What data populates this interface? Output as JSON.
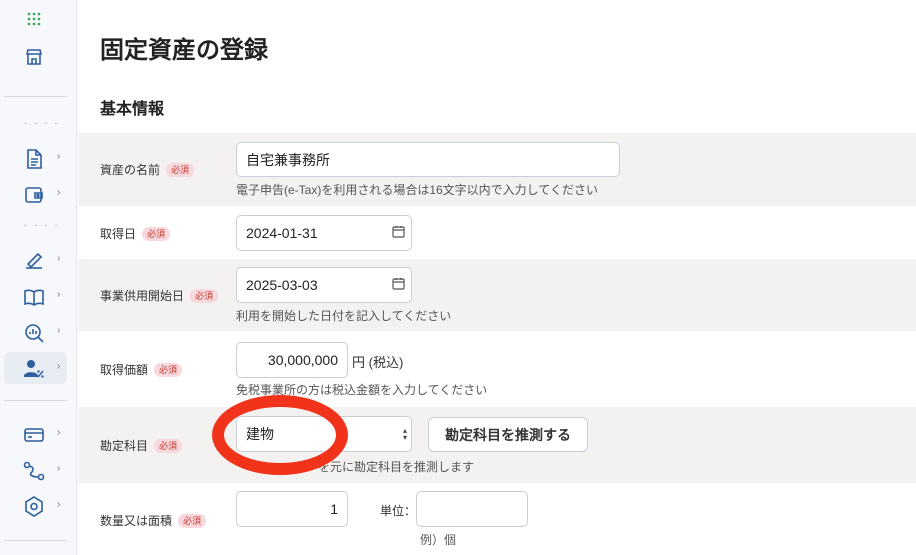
{
  "sidebar": {
    "dots": "· · · ·",
    "chevron": "›"
  },
  "page": {
    "title": "固定資産の登録",
    "section_title": "基本情報"
  },
  "form": {
    "required_badge": "必須",
    "asset_name": {
      "label": "資産の名前",
      "value": "自宅兼事務所",
      "hint": "電子申告(e-Tax)を利用される場合は16文字以内で入力してください"
    },
    "acquired_date": {
      "label": "取得日",
      "value": "2024-01-31"
    },
    "business_start_date": {
      "label": "事業供用開始日",
      "value": "2025-03-03",
      "hint": "利用を開始した日付を記入してください"
    },
    "acquisition_price": {
      "label": "取得価額",
      "value": "30,000,000",
      "unit": "円 (税込)",
      "hint": "免税事業所の方は税込金額を入力してください"
    },
    "account_item": {
      "label": "勘定科目",
      "selected": "建物",
      "suggest_button": "勘定科目を推測する",
      "hint": "を元に勘定科目を推測します"
    },
    "quantity": {
      "label": "数量又は面積",
      "value": "1",
      "unit_label": "単位：",
      "unit_value": "",
      "unit_hint": "例）個"
    }
  },
  "colors": {
    "annotation": "#f1331b",
    "required_badge_bg": "#f8d7dd",
    "required_badge_text": "#c0392b",
    "row_gray": "#f4f2f1"
  }
}
